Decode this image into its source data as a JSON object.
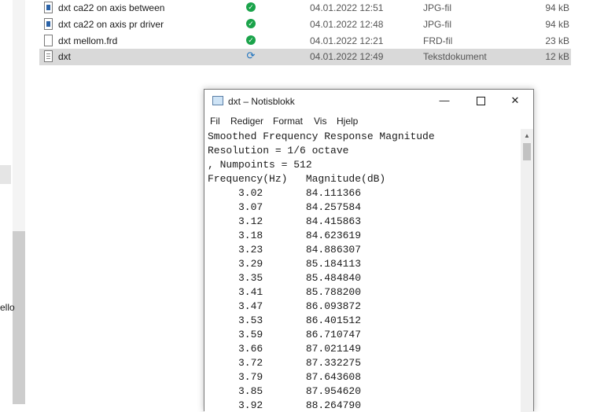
{
  "left_pane": {
    "cut_label": "ello"
  },
  "files": [
    {
      "name": "dxt ca22 on axis between",
      "status": "synced",
      "date": "04.01.2022 12:51",
      "type": "JPG-fil",
      "size": "94 kB",
      "icon": "image-file-icon",
      "selected": false
    },
    {
      "name": "dxt ca22 on axis pr driver",
      "status": "synced",
      "date": "04.01.2022 12:48",
      "type": "JPG-fil",
      "size": "94 kB",
      "icon": "image-file-icon",
      "selected": false
    },
    {
      "name": "dxt mellom.frd",
      "status": "synced",
      "date": "04.01.2022 12:21",
      "type": "FRD-fil",
      "size": "23 kB",
      "icon": "blank-file-icon",
      "selected": false
    },
    {
      "name": "dxt",
      "status": "syncing",
      "date": "04.01.2022 12:49",
      "type": "Tekstdokument",
      "size": "12 kB",
      "icon": "text-file-icon",
      "selected": true
    }
  ],
  "notepad": {
    "title": "dxt – Notisblokk",
    "menu": [
      "Fil",
      "Rediger",
      "Format",
      "Vis",
      "Hjelp"
    ],
    "lines": [
      "Smoothed Frequency Response Magnitude",
      "Resolution = 1/6 octave",
      ", Numpoints = 512",
      "Frequency(Hz)   Magnitude(dB)",
      "     3.02       84.111366",
      "     3.07       84.257584",
      "     3.12       84.415863",
      "     3.18       84.623619",
      "     3.23       84.886307",
      "     3.29       85.184113",
      "     3.35       85.484840",
      "     3.41       85.788200",
      "     3.47       86.093872",
      "     3.53       86.401512",
      "     3.59       86.710747",
      "     3.66       87.021149",
      "     3.72       87.332275",
      "     3.79       87.643608",
      "     3.85       87.954620",
      "     3.92       88.264790"
    ]
  }
}
